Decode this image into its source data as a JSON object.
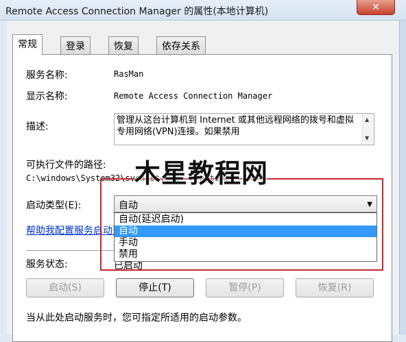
{
  "window": {
    "title": "Remote Access Connection Manager 的属性(本地计算机)",
    "close_glyph": "✕"
  },
  "tabs": [
    {
      "label": "常规"
    },
    {
      "label": "登录"
    },
    {
      "label": "恢复"
    },
    {
      "label": "依存关系"
    }
  ],
  "general": {
    "service_name_label": "服务名称:",
    "service_name_value": "RasMan",
    "display_name_label": "显示名称:",
    "display_name_value": "Remote Access Connection Manager",
    "description_label": "描述:",
    "description_value": "管理从这台计算机到 Internet 或其他远程网络的拨号和虚拟专用网络(VPN)连接。如果禁用",
    "exe_path_label": "可执行文件的路径:",
    "exe_path_value": "C:\\windows\\System32\\svchost.exe -k netsvcs",
    "startup_type_label": "启动类型(E):",
    "startup_type_value": "自动",
    "startup_options": [
      "自动(延迟启动)",
      "自动",
      "手动",
      "禁用"
    ],
    "selected_option_index": 1,
    "help_link": "帮助我配置服务启动选项。",
    "status_label": "服务状态:",
    "status_value": "已启动",
    "buttons": {
      "start": "启动(S)",
      "stop": "停止(T)",
      "pause": "暂停(P)",
      "resume": "恢复(R)"
    },
    "hint": "当从此处启动服务时，您可指定所适用的启动参数。"
  },
  "watermark": "木星教程网",
  "colors": {
    "selection": "#3399ff",
    "highlight_box": "#c0272d",
    "link": "#0033cc"
  }
}
